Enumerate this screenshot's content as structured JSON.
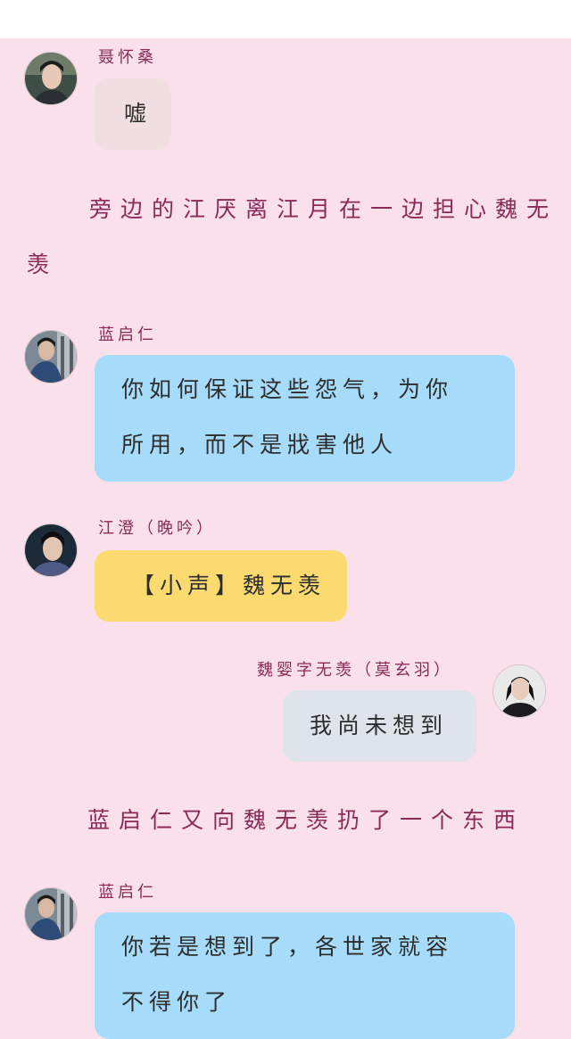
{
  "messages": [
    {
      "speaker": "聂怀桑",
      "text": "嘘"
    },
    {
      "speaker": "蓝启仁",
      "text_lines": [
        "你如何保证这些怨气，为你",
        "所用，而不是戕害他人"
      ]
    },
    {
      "speaker": "江澄（晚吟）",
      "text": "【小声】魏无羡"
    },
    {
      "speaker": "魏婴字无羡（莫玄羽）",
      "text": "我尚未想到"
    },
    {
      "speaker": "蓝启仁",
      "text_lines": [
        "你若是想到了，各世家就容",
        "不得你了"
      ]
    }
  ],
  "narration": {
    "first_lines": [
      "旁边的江厌离江月在一边担心魏无",
      "羡"
    ],
    "second": "蓝启仁又向魏无羡扔了一个东西"
  },
  "colors": {
    "background": "#fae0ea",
    "name_text": "#8b2a56",
    "bubble_blue": "#a6dcfa",
    "bubble_yellow": "#fbdb6f",
    "bubble_gray": "#f1dfe2",
    "bubble_self": "#dfe3ea"
  }
}
